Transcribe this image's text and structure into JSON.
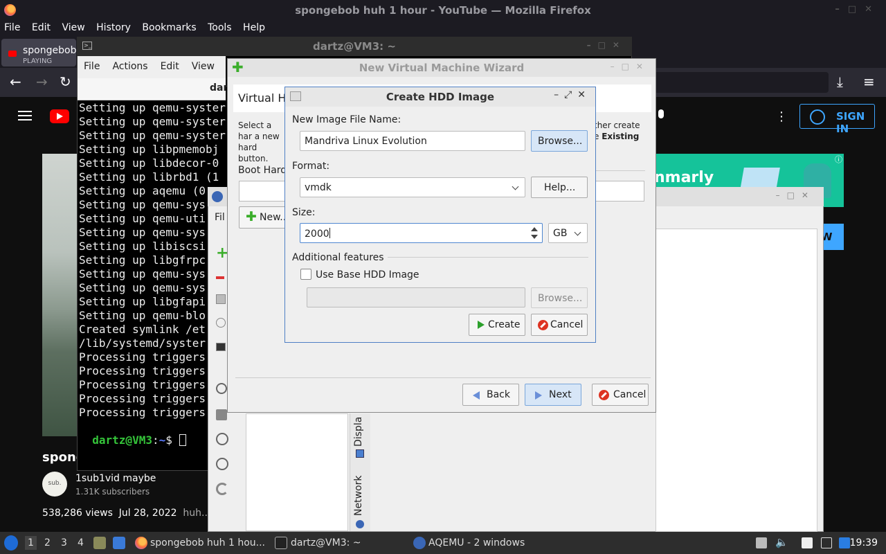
{
  "firefox": {
    "window_title": "spongebob huh 1 hour - YouTube — Mozilla Firefox",
    "menu": [
      "File",
      "Edit",
      "View",
      "History",
      "Bookmarks",
      "Tools",
      "Help"
    ],
    "tab": {
      "title": "spongebob",
      "status": "PLAYING"
    }
  },
  "youtube": {
    "sign_in": "SIGN IN",
    "video_title": "spong",
    "channel": "1sub1vid maybe",
    "subscribers": "1.31K subscribers",
    "avatar_text": "sub.",
    "views": "538,286 views",
    "date": "Jul 28, 2022",
    "desc": "huh...mo",
    "ad_text": "nmarly",
    "ad_info": "ⓘ",
    "blue_btn": "W"
  },
  "terminal": {
    "window_title": "dartz@VM3: ~",
    "menu": [
      "File",
      "Actions",
      "Edit",
      "View"
    ],
    "tab_label": "dar",
    "lines": [
      "Setting up qemu-syster",
      "Setting up qemu-syster",
      "Setting up qemu-syster",
      "Setting up libpmemobj",
      "Setting up libdecor-0",
      "Setting up librbd1 (1",
      "Setting up aqemu (0",
      "Setting up qemu-sys",
      "Setting up qemu-uti",
      "Setting up qemu-sys",
      "Setting up libiscsi",
      "Setting up libgfrpc",
      "Setting up qemu-sys",
      "Setting up qemu-sys",
      "Setting up libgfapi",
      "Setting up qemu-blo",
      "Created symlink /et",
      "/lib/systemd/syster",
      "Processing triggers",
      "Processing triggers",
      "Processing triggers",
      "Processing triggers",
      "Processing triggers"
    ],
    "prompt_user": "dartz@VM3",
    "prompt_sep": ":",
    "prompt_path": "~",
    "prompt_char": "$ "
  },
  "aqemu": {
    "menu_first": "Fil",
    "vtabs": [
      "Displa",
      "Network"
    ]
  },
  "wizard": {
    "window_title": "New Virtual Machine Wizard",
    "header": "Virtual Ha",
    "desc_left": "Select a har a new hard button.",
    "desc_right_1": "ther create",
    "desc_right_2": "e ",
    "desc_right_bold": "Existing",
    "boot_label": "Boot Hard",
    "new_button": "New...",
    "back_button": "Back",
    "next_button": "Next",
    "cancel_button": "Cancel"
  },
  "hdd_dialog": {
    "title": "Create HDD Image",
    "name_label": "New Image File Name:",
    "name_value": "Mandriva Linux Evolution",
    "browse_button": "Browse...",
    "format_label": "Format:",
    "format_value": "vmdk",
    "help_button": "Help...",
    "size_label": "Size:",
    "size_value": "2000",
    "unit_value": "GB",
    "features_label": "Additional features",
    "base_label": "Use Base HDD Image",
    "browse2_button": "Browse...",
    "create_button": "Create",
    "cancel_button": "Cancel"
  },
  "taskbar": {
    "workspaces": [
      "1",
      "2",
      "3",
      "4"
    ],
    "apps": [
      "spongebob huh 1 hou...",
      "dartz@VM3: ~",
      "AQEMU - 2 windows"
    ],
    "clock": "19:39"
  }
}
